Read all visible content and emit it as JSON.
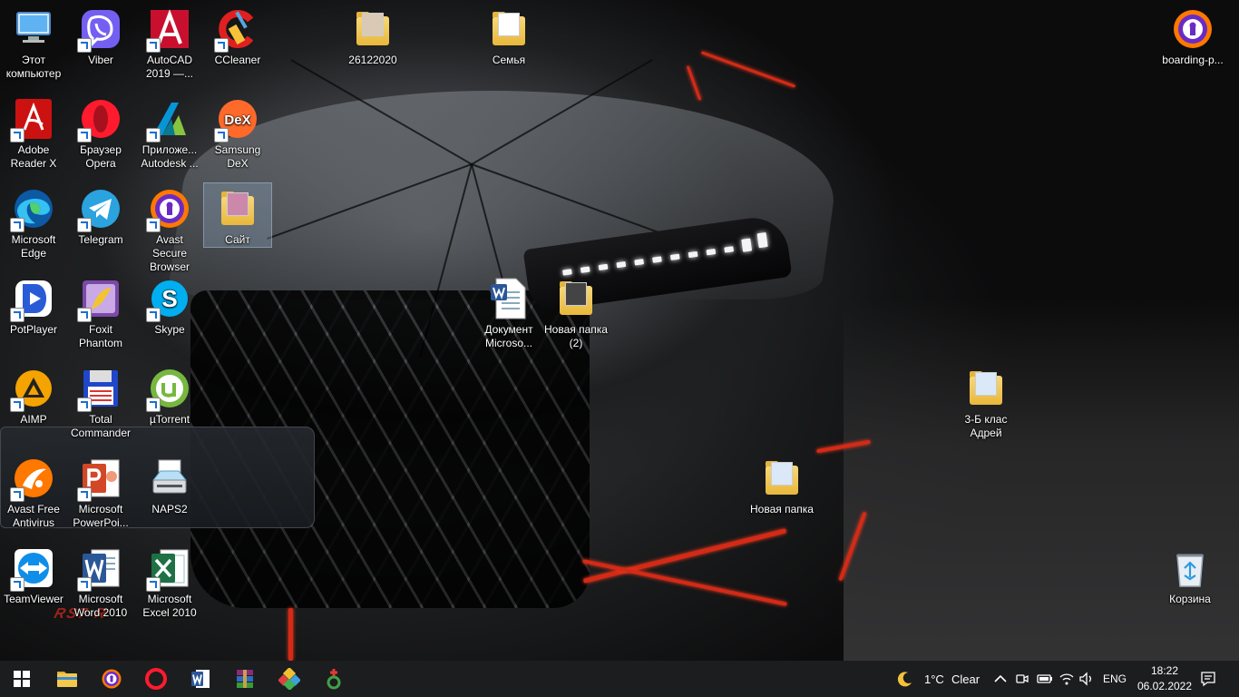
{
  "desktop": {
    "icons": [
      {
        "id": "this-pc",
        "label": "Этот компьютер"
      },
      {
        "id": "viber",
        "label": "Viber"
      },
      {
        "id": "autocad",
        "label": "AutoCAD 2019 —..."
      },
      {
        "id": "ccleaner",
        "label": "CCleaner"
      },
      {
        "id": "folder-26122020",
        "label": "26122020"
      },
      {
        "id": "folder-semya",
        "label": "Семья"
      },
      {
        "id": "boarding",
        "label": "boarding-p..."
      },
      {
        "id": "adobe-reader",
        "label": "Adobe Reader X"
      },
      {
        "id": "opera",
        "label": "Браузер Opera"
      },
      {
        "id": "autodesk-app",
        "label": "Приложе... Autodesk ..."
      },
      {
        "id": "samsung-dex",
        "label": "Samsung DeX"
      },
      {
        "id": "edge",
        "label": "Microsoft Edge"
      },
      {
        "id": "telegram",
        "label": "Telegram"
      },
      {
        "id": "avast-browser",
        "label": "Avast Secure Browser"
      },
      {
        "id": "folder-sayt",
        "label": "Сайт"
      },
      {
        "id": "potplayer",
        "label": "PotPlayer"
      },
      {
        "id": "foxit",
        "label": "Foxit Phantom"
      },
      {
        "id": "skype",
        "label": "Skype"
      },
      {
        "id": "word-doc",
        "label": "Документ Microso..."
      },
      {
        "id": "folder-new-2",
        "label": "Новая папка (2)"
      },
      {
        "id": "aimp",
        "label": "AIMP"
      },
      {
        "id": "total-commander",
        "label": "Total Commander"
      },
      {
        "id": "utorrent",
        "label": "µTorrent"
      },
      {
        "id": "folder-3b",
        "label": "3-Б клас Адрей"
      },
      {
        "id": "avast-antivirus",
        "label": "Avast Free Antivirus"
      },
      {
        "id": "powerpoint",
        "label": "Microsoft PowerPoi..."
      },
      {
        "id": "naps2",
        "label": "NAPS2"
      },
      {
        "id": "folder-new",
        "label": "Новая папка"
      },
      {
        "id": "teamviewer",
        "label": "TeamViewer"
      },
      {
        "id": "word-2010",
        "label": "Microsoft Word 2010"
      },
      {
        "id": "excel-2010",
        "label": "Microsoft Excel 2010"
      },
      {
        "id": "recycle-bin",
        "label": "Корзина"
      }
    ],
    "selected_icon": "Сайт"
  },
  "taskbar": {
    "pinned": [
      "start-icon",
      "file-explorer-icon",
      "avast-browser-icon",
      "opera-icon",
      "word-icon",
      "winrar-icon",
      "app-icon",
      "app-icon-2"
    ],
    "weather": {
      "temp": "1°C",
      "condition": "Clear"
    },
    "language": "ENG",
    "time": "18:22",
    "date": "06.02.2022"
  },
  "colors": {
    "taskbar": "#1c1d1f",
    "accent_red": "#d42a16",
    "selection": "#96b4d2"
  }
}
